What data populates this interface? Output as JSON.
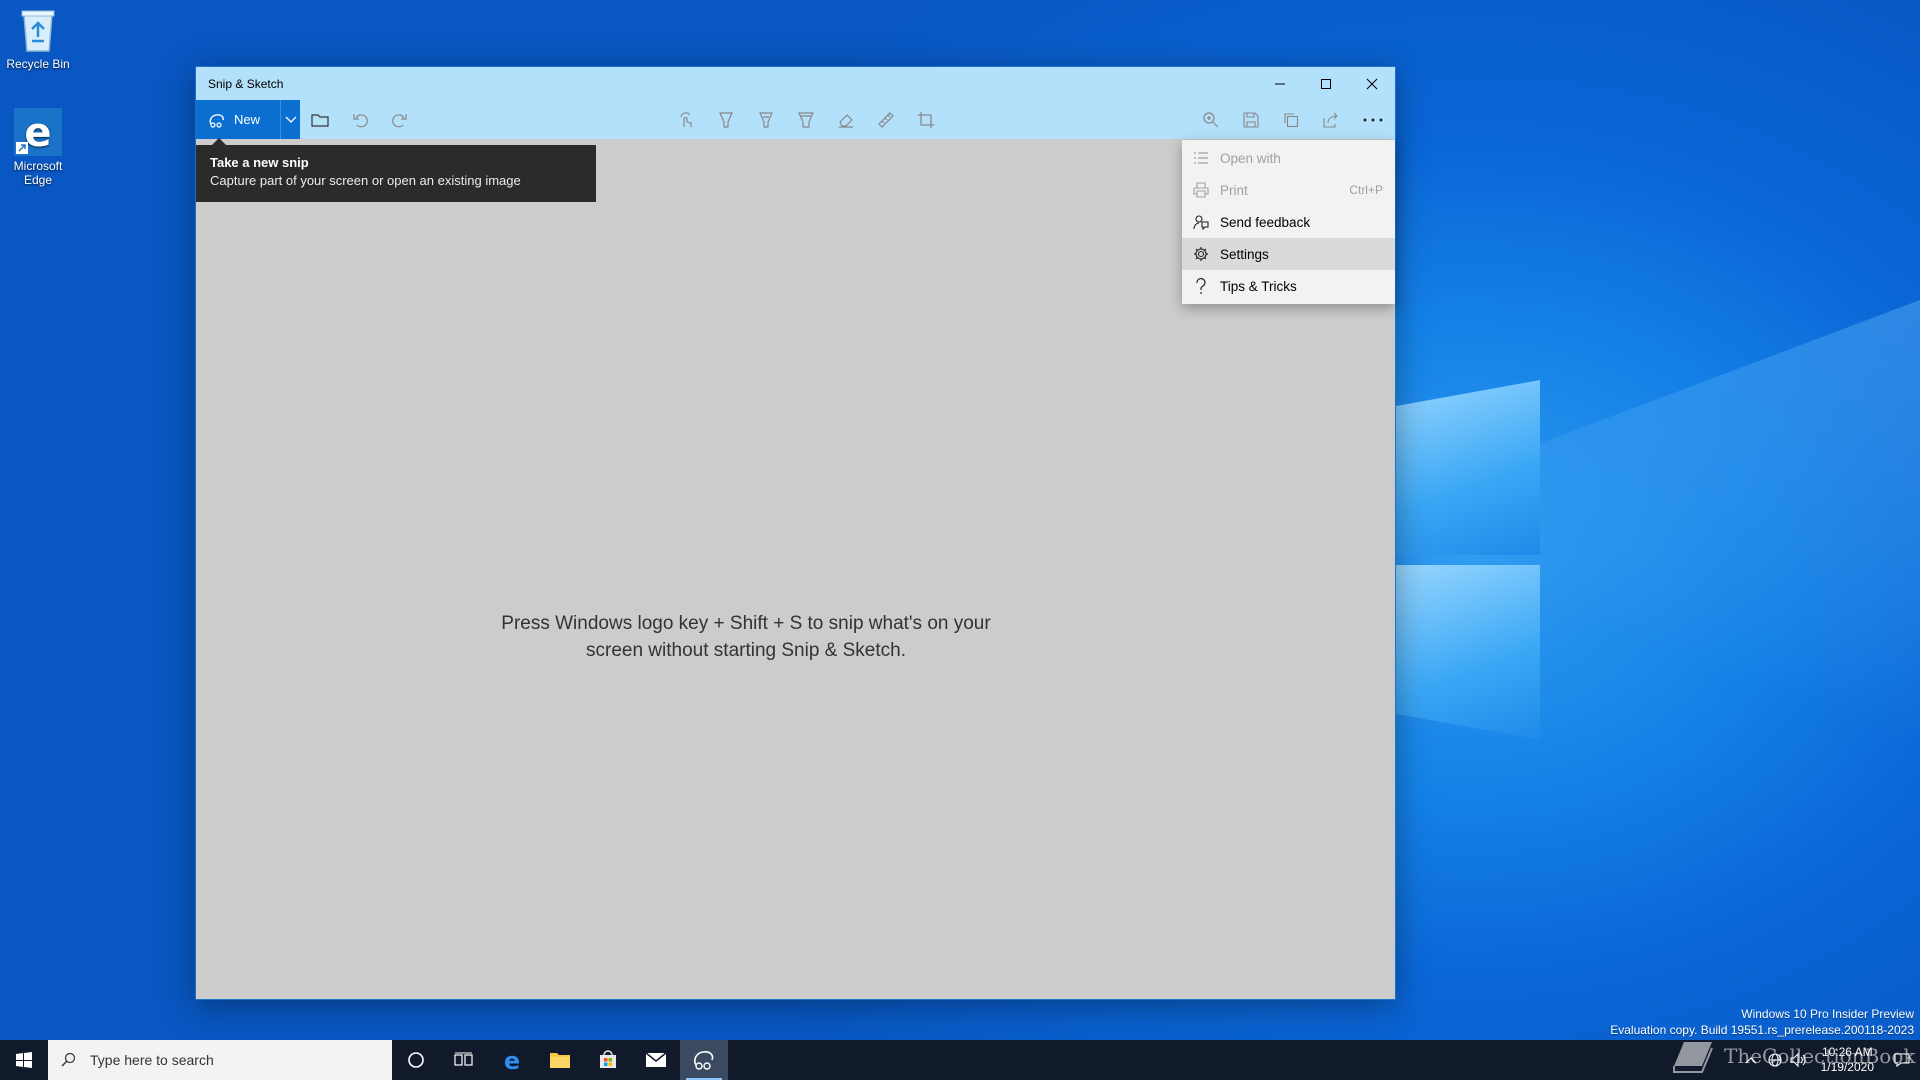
{
  "desktop": {
    "icons": [
      {
        "label": "Recycle Bin"
      },
      {
        "label": "Microsoft Edge"
      }
    ]
  },
  "window": {
    "title": "Snip & Sketch",
    "toolbar": {
      "new_label": "New"
    },
    "tooltip": {
      "title": "Take a new snip",
      "description": "Capture part of your screen or open an existing image"
    },
    "hint_line1": "Press Windows logo key + Shift + S to snip what's on your",
    "hint_line2": "screen without starting Snip & Sketch.",
    "menu": {
      "items": [
        {
          "label": "Open with",
          "icon": "open-with-icon",
          "disabled": true
        },
        {
          "label": "Print",
          "icon": "print-icon",
          "shortcut": "Ctrl+P",
          "disabled": true
        },
        {
          "label": "Send feedback",
          "icon": "feedback-icon"
        },
        {
          "label": "Settings",
          "icon": "gear-icon",
          "highlighted": true
        },
        {
          "label": "Tips & Tricks",
          "icon": "question-icon"
        }
      ]
    }
  },
  "watermark": {
    "line1": "Windows 10 Pro Insider Preview",
    "line2": "Evaluation copy. Build 19551.rs_prerelease.200118-2023"
  },
  "taskbar": {
    "search_placeholder": "Type here to search",
    "time": "10:26 AM",
    "date": "1/19/2020"
  },
  "overlay": {
    "brand": "TheCollectionBook"
  },
  "colors": {
    "accent": "#0a6fd1",
    "titlebar": "#b3e1fb",
    "canvas": "#cccccc",
    "taskbar": "#101a2b"
  }
}
